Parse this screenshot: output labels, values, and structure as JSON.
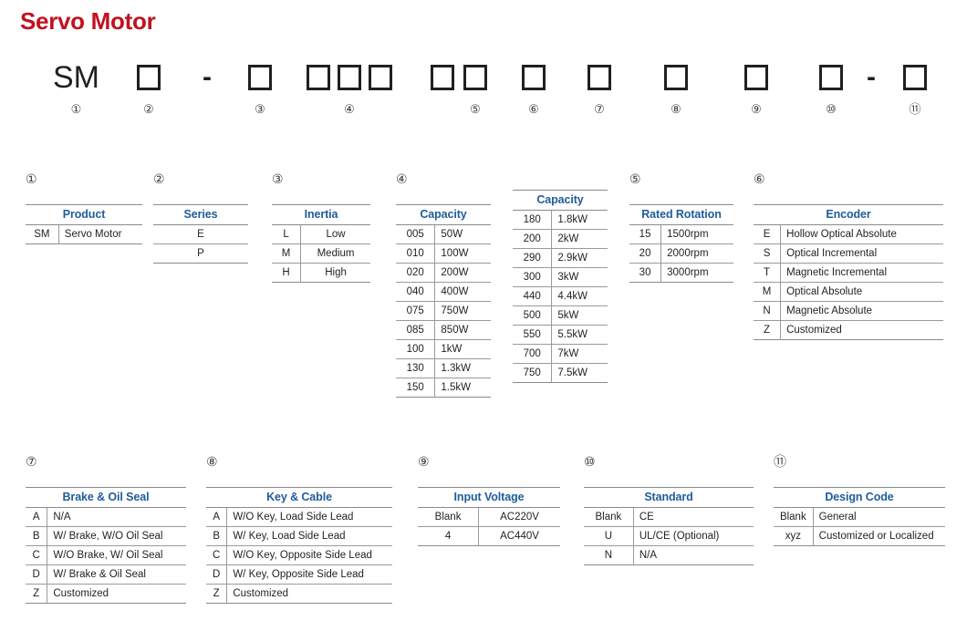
{
  "title": "Servo Motor",
  "model_code": {
    "segments": [
      {
        "kind": "text",
        "text": "SM",
        "num": "①"
      },
      {
        "kind": "box",
        "text": "",
        "num": "②"
      },
      {
        "kind": "dash",
        "text": "-",
        "num": ""
      },
      {
        "kind": "box",
        "text": "",
        "num": "③"
      },
      {
        "kind": "box",
        "text": "",
        "num": ""
      },
      {
        "kind": "box",
        "text": "",
        "num": "④"
      },
      {
        "kind": "box",
        "text": "",
        "num": ""
      },
      {
        "kind": "box",
        "text": "",
        "num": ""
      },
      {
        "kind": "box",
        "text": "",
        "num": "⑤"
      },
      {
        "kind": "box",
        "text": "",
        "num": "⑥"
      },
      {
        "kind": "box",
        "text": "",
        "num": "⑦"
      },
      {
        "kind": "box",
        "text": "",
        "num": "⑧"
      },
      {
        "kind": "box",
        "text": "",
        "num": "⑨"
      },
      {
        "kind": "box",
        "text": "",
        "num": "⑩"
      },
      {
        "kind": "dash",
        "text": "-",
        "num": ""
      },
      {
        "kind": "box",
        "text": "",
        "num": "⑪"
      }
    ]
  },
  "sections": [
    {
      "num": "①",
      "header": "Product",
      "layout": "pair",
      "rows": [
        [
          "SM",
          "Servo Motor"
        ]
      ]
    },
    {
      "num": "②",
      "header": "Series",
      "layout": "single",
      "rows": [
        [
          "E"
        ],
        [
          "P"
        ]
      ]
    },
    {
      "num": "③",
      "header": "Inertia",
      "layout": "pair-center",
      "rows": [
        [
          "L",
          "Low"
        ],
        [
          "M",
          "Medium"
        ],
        [
          "H",
          "High"
        ]
      ]
    },
    {
      "num": "④",
      "header": "Capacity",
      "layout": "pair",
      "rows": [
        [
          "005",
          "50W"
        ],
        [
          "010",
          "100W"
        ],
        [
          "020",
          "200W"
        ],
        [
          "040",
          "400W"
        ],
        [
          "075",
          "750W"
        ],
        [
          "085",
          "850W"
        ],
        [
          "100",
          "1kW"
        ],
        [
          "130",
          "1.3kW"
        ],
        [
          "150",
          "1.5kW"
        ]
      ]
    },
    {
      "num": "",
      "header": "Capacity",
      "layout": "pair",
      "rows": [
        [
          "180",
          "1.8kW"
        ],
        [
          "200",
          "2kW"
        ],
        [
          "290",
          "2.9kW"
        ],
        [
          "300",
          "3kW"
        ],
        [
          "440",
          "4.4kW"
        ],
        [
          "500",
          "5kW"
        ],
        [
          "550",
          "5.5kW"
        ],
        [
          "700",
          "7kW"
        ],
        [
          "750",
          "7.5kW"
        ]
      ]
    },
    {
      "num": "⑤",
      "header": "Rated Rotation",
      "layout": "pair",
      "rows": [
        [
          "15",
          "1500rpm"
        ],
        [
          "20",
          "2000rpm"
        ],
        [
          "30",
          "3000rpm"
        ]
      ]
    },
    {
      "num": "⑥",
      "header": "Encoder",
      "layout": "pair",
      "rows": [
        [
          "E",
          "Hollow Optical Absolute"
        ],
        [
          "S",
          "Optical Incremental"
        ],
        [
          "T",
          "Magnetic Incremental"
        ],
        [
          "M",
          "Optical Absolute"
        ],
        [
          "N",
          "Magnetic Absolute"
        ],
        [
          "Z",
          "Customized"
        ]
      ]
    },
    {
      "num": "⑦",
      "header": "Brake & Oil Seal",
      "layout": "pair",
      "rows": [
        [
          "A",
          "N/A"
        ],
        [
          "B",
          "W/ Brake, W/O Oil Seal"
        ],
        [
          "C",
          "W/O Brake, W/ Oil Seal"
        ],
        [
          "D",
          "W/ Brake & Oil Seal"
        ],
        [
          "Z",
          "Customized"
        ]
      ]
    },
    {
      "num": "⑧",
      "header": "Key & Cable",
      "layout": "pair",
      "rows": [
        [
          "A",
          "W/O Key, Load Side Lead"
        ],
        [
          "B",
          "W/ Key, Load Side Lead"
        ],
        [
          "C",
          "W/O Key, Opposite Side Lead"
        ],
        [
          "D",
          "W/ Key, Opposite Side Lead"
        ],
        [
          "Z",
          "Customized"
        ]
      ]
    },
    {
      "num": "⑨",
      "header": "Input Voltage",
      "layout": "pair-center",
      "rows": [
        [
          "Blank",
          "AC220V"
        ],
        [
          "4",
          "AC440V"
        ]
      ]
    },
    {
      "num": "⑩",
      "header": "Standard",
      "layout": "pair",
      "rows": [
        [
          "Blank",
          "CE"
        ],
        [
          "U",
          "UL/CE (Optional)"
        ],
        [
          "N",
          "N/A"
        ]
      ]
    },
    {
      "num": "⑪",
      "header": "Design Code",
      "layout": "pair",
      "rows": [
        [
          "Blank",
          "General"
        ],
        [
          "xyz",
          "Customized or Localized"
        ]
      ],
      "tall_rows": [
        1
      ]
    }
  ],
  "colors": {
    "title": "#c1121f",
    "table_header": "#1f5c99",
    "rule": "#8a8a8a",
    "text": "#231f20"
  }
}
